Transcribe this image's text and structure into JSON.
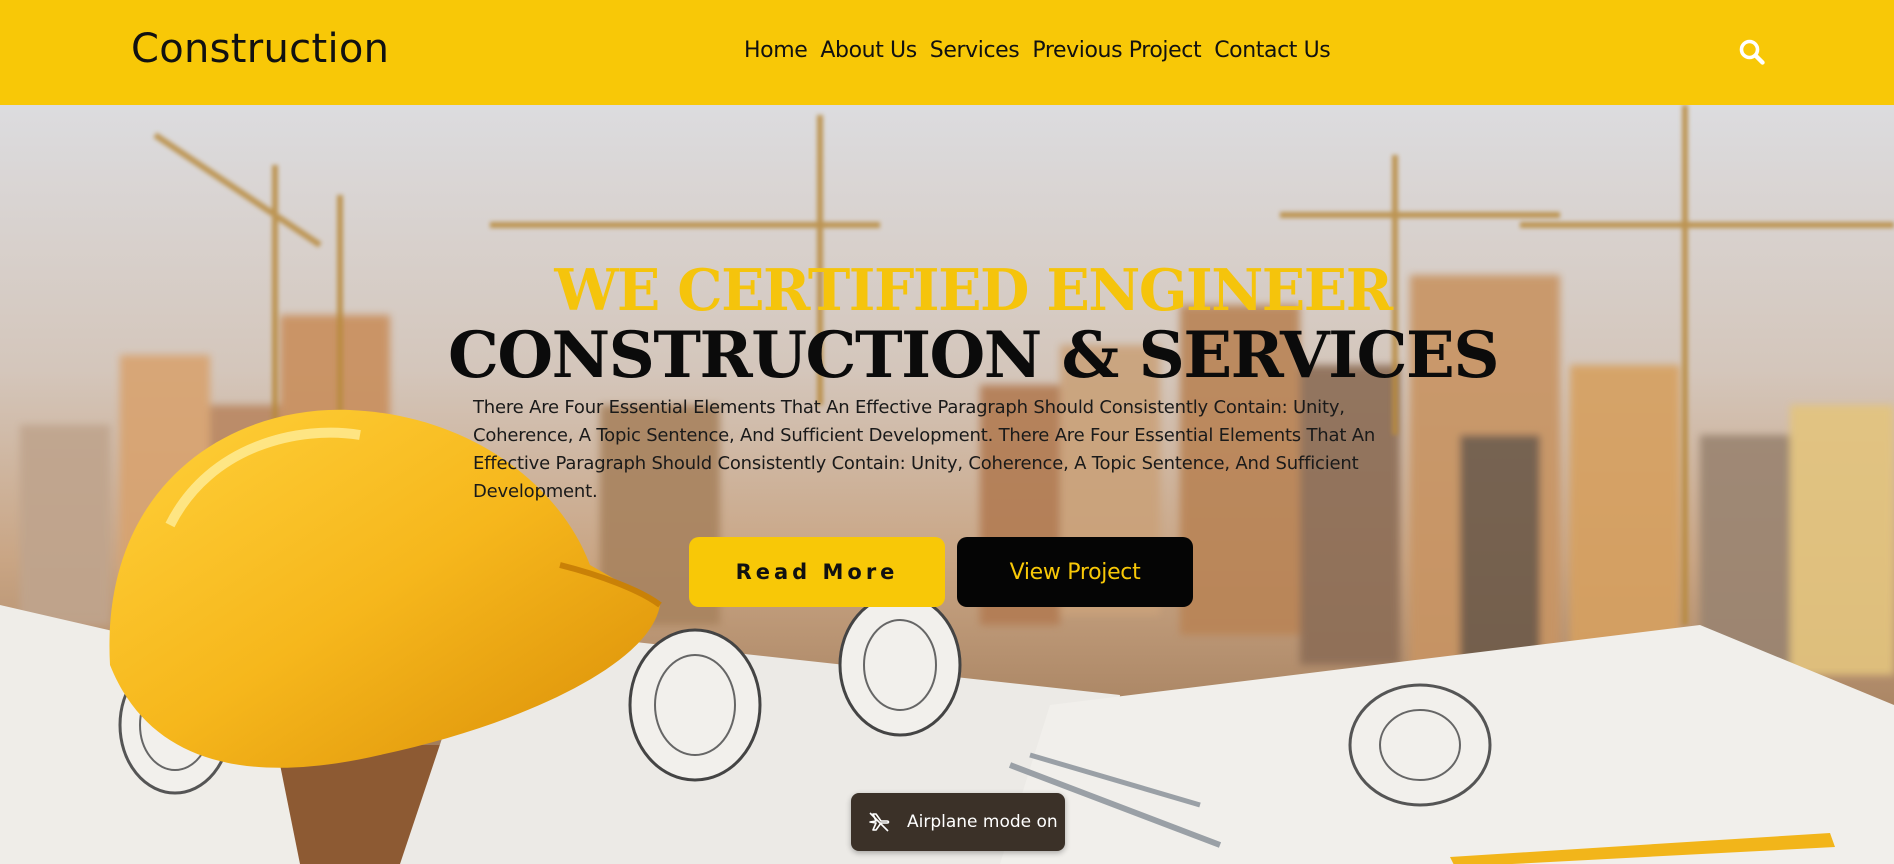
{
  "header": {
    "logo": "Construction",
    "nav": [
      "Home",
      "About Us",
      "Services",
      "Previous Project",
      "Contact Us"
    ],
    "search_icon": "search-icon"
  },
  "hero": {
    "headline_top": "WE CERTIFIED ENGINEER",
    "headline_bottom": "CONSTRUCTION & SERVICES",
    "paragraph": "There Are Four Essential Elements That An Effective Paragraph Should Consistently Contain: Unity, Coherence, A Topic Sentence, And Sufficient Development. There Are Four Essential Elements That An Effective Paragraph Should Consistently Contain: Unity, Coherence, A Topic Sentence, And Sufficient Development.",
    "read_more_label": "Read More",
    "view_project_label": "View Project"
  },
  "toast": {
    "icon": "airplane-icon",
    "text": "Airplane mode on"
  },
  "colors": {
    "accent": "#f8c807",
    "dark": "#050505",
    "headline_yellow": "#f5c40c"
  }
}
